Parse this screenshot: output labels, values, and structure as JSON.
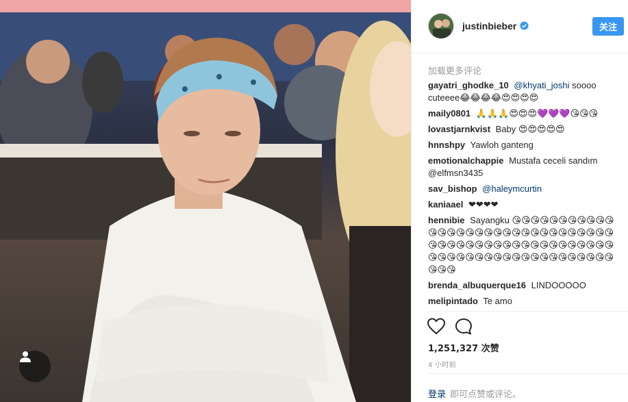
{
  "post": {
    "username": "justinbieber",
    "follow_label": "关注",
    "load_more": "加载更多评论",
    "likes": "1,251,327 次赞",
    "time": "4 小时前",
    "login_link": "登录",
    "login_text": "即可点赞或评论。"
  },
  "comments": [
    {
      "user": "gayatri_ghodke_10",
      "mention": "@khyati_joshi",
      "text": "soooo cuteeee😂😂😂😂😍😍😍😍"
    },
    {
      "user": "maily0801",
      "mention": "",
      "text": "🙏🙏🙏😍😍😍💜💜💜😘😘😘"
    },
    {
      "user": "lovastjarnkvist",
      "mention": "",
      "text": "Baby 😍😍😍😍😍"
    },
    {
      "user": "hnnshpy",
      "mention": "",
      "text": "Yawloh ganteng"
    },
    {
      "user": "emotionalchappie",
      "mention": "",
      "text": "Mustafa ceceli sandım @elfmsn3435"
    },
    {
      "user": "sav_bishop",
      "mention": "@haleymcurtin",
      "text": ""
    },
    {
      "user": "kaniaael",
      "mention": "",
      "text": "❤❤❤❤"
    },
    {
      "user": "hennibie",
      "mention": "",
      "text": "Sayangku 😘😘😘😘😘😘😘😘😘😘😘😘😘😘😘😘😘😘😘😘😘😘😘😘😘😘😘😘😘😘😘😘😘😘😘😘😘😘😘😘😘😘😘😘😘😘😘😘😘😘😘😘😘😘😘😘😘😘😘😘😘😘😘😘😘😘😘😘😘😘😘😘😘😘"
    },
    {
      "user": "brenda_albuquerque16",
      "mention": "",
      "text": "LINDOOOOO"
    },
    {
      "user": "melipintado",
      "mention": "",
      "text": "Te amo"
    }
  ],
  "icons": {
    "verified": "verified-badge-icon",
    "like": "heart-icon",
    "comment": "comment-bubble-icon",
    "user_tag": "user-tag-icon"
  },
  "colors": {
    "accent": "#3897f0",
    "link": "#003569",
    "muted": "#999999",
    "text": "#262626"
  }
}
